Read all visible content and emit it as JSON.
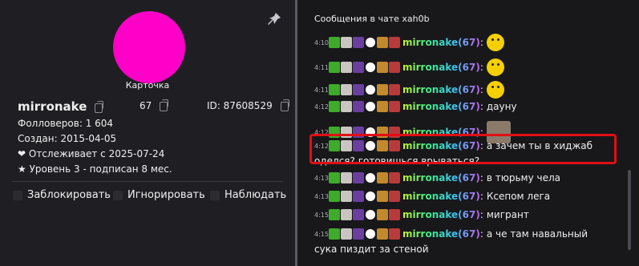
{
  "profile": {
    "card_label": "Карточка",
    "username": "mirronake",
    "count": "67",
    "id": "ID: 87608529",
    "followers": "Фолловеров: 1 604",
    "created": "Создан: 2015-04-05",
    "following_since": "❤ Отслеживает с 2025-07-24",
    "level": "★ Уровень 3 - подписан 8 мес.",
    "actions": [
      "Заблокировать",
      "Игнорировать",
      "Наблюдать"
    ],
    "avatar_color": "#ff00c8"
  },
  "chat": {
    "title": "Сообщения в чате xah0b",
    "nick": "mirronake(67)",
    "messages": [
      {
        "time": "4:10",
        "text": "",
        "emote": "smiley-emote"
      },
      {
        "time": "4:11",
        "text": "",
        "emote": "smiley-emote"
      },
      {
        "time": "4:11",
        "text": "",
        "emote": "smiley-emote"
      },
      {
        "time": "4:12",
        "text": "дауну"
      },
      {
        "time": "4:12",
        "text": "",
        "emote": "cat-emote"
      },
      {
        "time": "4:12",
        "text": "а зачем ты в хиджаб",
        "cont": "оделся? готовишься врываться?"
      },
      {
        "time": "4:13",
        "text": "в тюрьму чела"
      },
      {
        "time": "4:13",
        "text": "Ксепом лега"
      },
      {
        "time": "4:15",
        "text": "мигрант"
      },
      {
        "time": "4:15",
        "text": "а че там навальный",
        "cont": "сука пиздит за стеной"
      }
    ],
    "highlight_color": "#e10f14"
  }
}
